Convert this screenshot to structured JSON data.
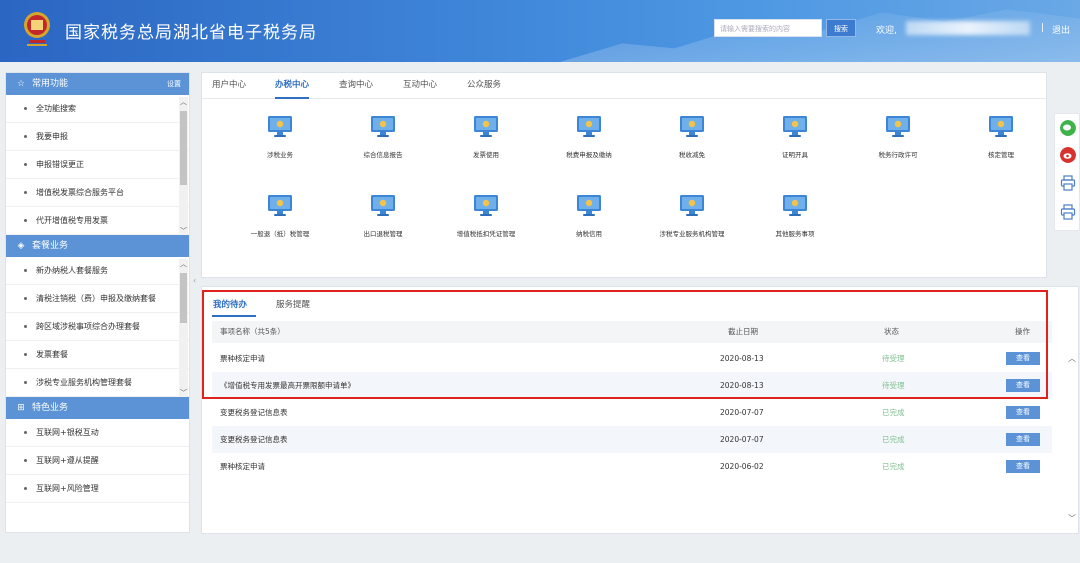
{
  "header": {
    "title": "国家税务总局湖北省电子税务局",
    "search_placeholder": "请输入需要搜索的内容",
    "search_button": "搜索",
    "welcome": "欢迎,",
    "separator": "|",
    "logout": "退出"
  },
  "sidebar": {
    "groups": [
      {
        "title": "常用功能",
        "icon": "star-icon",
        "action": "设置",
        "items": [
          "全功能搜索",
          "我要申报",
          "申报错误更正",
          "增值税发票综合服务平台",
          "代开增值税专用发票"
        ]
      },
      {
        "title": "套餐业务",
        "icon": "layers-icon",
        "items": [
          "新办纳税人套餐服务",
          "清税注销税（费）申报及缴纳套餐",
          "跨区域涉税事项综合办理套餐",
          "发票套餐",
          "涉税专业服务机构管理套餐"
        ]
      },
      {
        "title": "特色业务",
        "icon": "grid-icon",
        "items": [
          "互联网+银税互动",
          "互联网+遵从提醒",
          "互联网+风险管理"
        ]
      }
    ]
  },
  "main": {
    "tabs": [
      "用户中心",
      "办税中心",
      "查询中心",
      "互动中心",
      "公众服务"
    ],
    "active_tab": "办税中心",
    "services": [
      "涉税业务",
      "综合信息报告",
      "发票使用",
      "税费申报及缴纳",
      "税收减免",
      "证明开具",
      "税务行政许可",
      "核定管理",
      "一般退（抵）税管理",
      "出口退税管理",
      "增值税抵扣凭证管理",
      "纳税信用",
      "涉税专业服务机构管理",
      "其他服务事项"
    ]
  },
  "todo": {
    "tabs": [
      "我的待办",
      "服务提醒"
    ],
    "columns": {
      "name": "事项名称（共5条）",
      "date": "截止日期",
      "status": "状态",
      "op": "操作"
    },
    "rows": [
      {
        "name": "票种核定申请",
        "date": "2020-08-13",
        "status": "待受理",
        "action": "查看"
      },
      {
        "name": "《增值税专用发票最高开票限额申请单》",
        "date": "2020-08-13",
        "status": "待受理",
        "action": "查看"
      },
      {
        "name": "变更税务登记信息表",
        "date": "2020-07-07",
        "status": "已完成",
        "action": "查看"
      },
      {
        "name": "变更税务登记信息表",
        "date": "2020-07-07",
        "status": "已完成",
        "action": "查看"
      },
      {
        "name": "票种核定申请",
        "date": "2020-06-02",
        "status": "已完成",
        "action": "查看"
      }
    ]
  },
  "colors": {
    "header_blue": "#2b66c2",
    "accent": "#2f6fc2",
    "group_head": "#5b93d6",
    "highlight_box": "#e0221e",
    "status": "#7fbf8e"
  },
  "floatbar_icons": [
    "wechat-icon",
    "weibo-icon",
    "printer-icon",
    "printer-icon"
  ]
}
